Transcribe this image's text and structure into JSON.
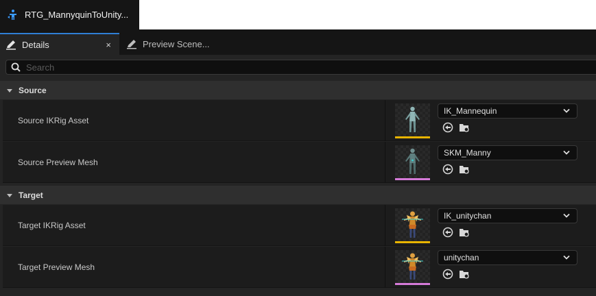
{
  "asset_tab": {
    "title": "RTG_MannyquinToUnity...",
    "icon": "retargeter-asset-icon"
  },
  "panel_tabs": [
    {
      "label": "Details",
      "icon": "pencil-icon",
      "active": true,
      "close_label": "×"
    },
    {
      "label": "Preview Scene...",
      "icon": "pencil-icon",
      "active": false
    }
  ],
  "search": {
    "placeholder": "Search",
    "value": ""
  },
  "sections": [
    {
      "title": "Source",
      "properties": [
        {
          "label": "Source IKRig Asset",
          "value": "IK_Mannequin",
          "asset_type": "ikrig",
          "thumbnail": "mannequin-figure"
        },
        {
          "label": "Source Preview Mesh",
          "value": "SKM_Manny",
          "asset_type": "skeletal-mesh",
          "thumbnail": "mannequin-figure"
        }
      ]
    },
    {
      "title": "Target",
      "properties": [
        {
          "label": "Target IKRig Asset",
          "value": "IK_unitychan",
          "asset_type": "ikrig",
          "thumbnail": "unitychan-figure"
        },
        {
          "label": "Target Preview Mesh",
          "value": "unitychan",
          "asset_type": "skeletal-mesh",
          "thumbnail": "unitychan-figure"
        }
      ]
    }
  ],
  "colors": {
    "accent_tab": "#2f7fd6",
    "ikrig_bar": "#e8b400",
    "mesh_bar": "#d57ad8",
    "panel_bg": "#242424"
  }
}
